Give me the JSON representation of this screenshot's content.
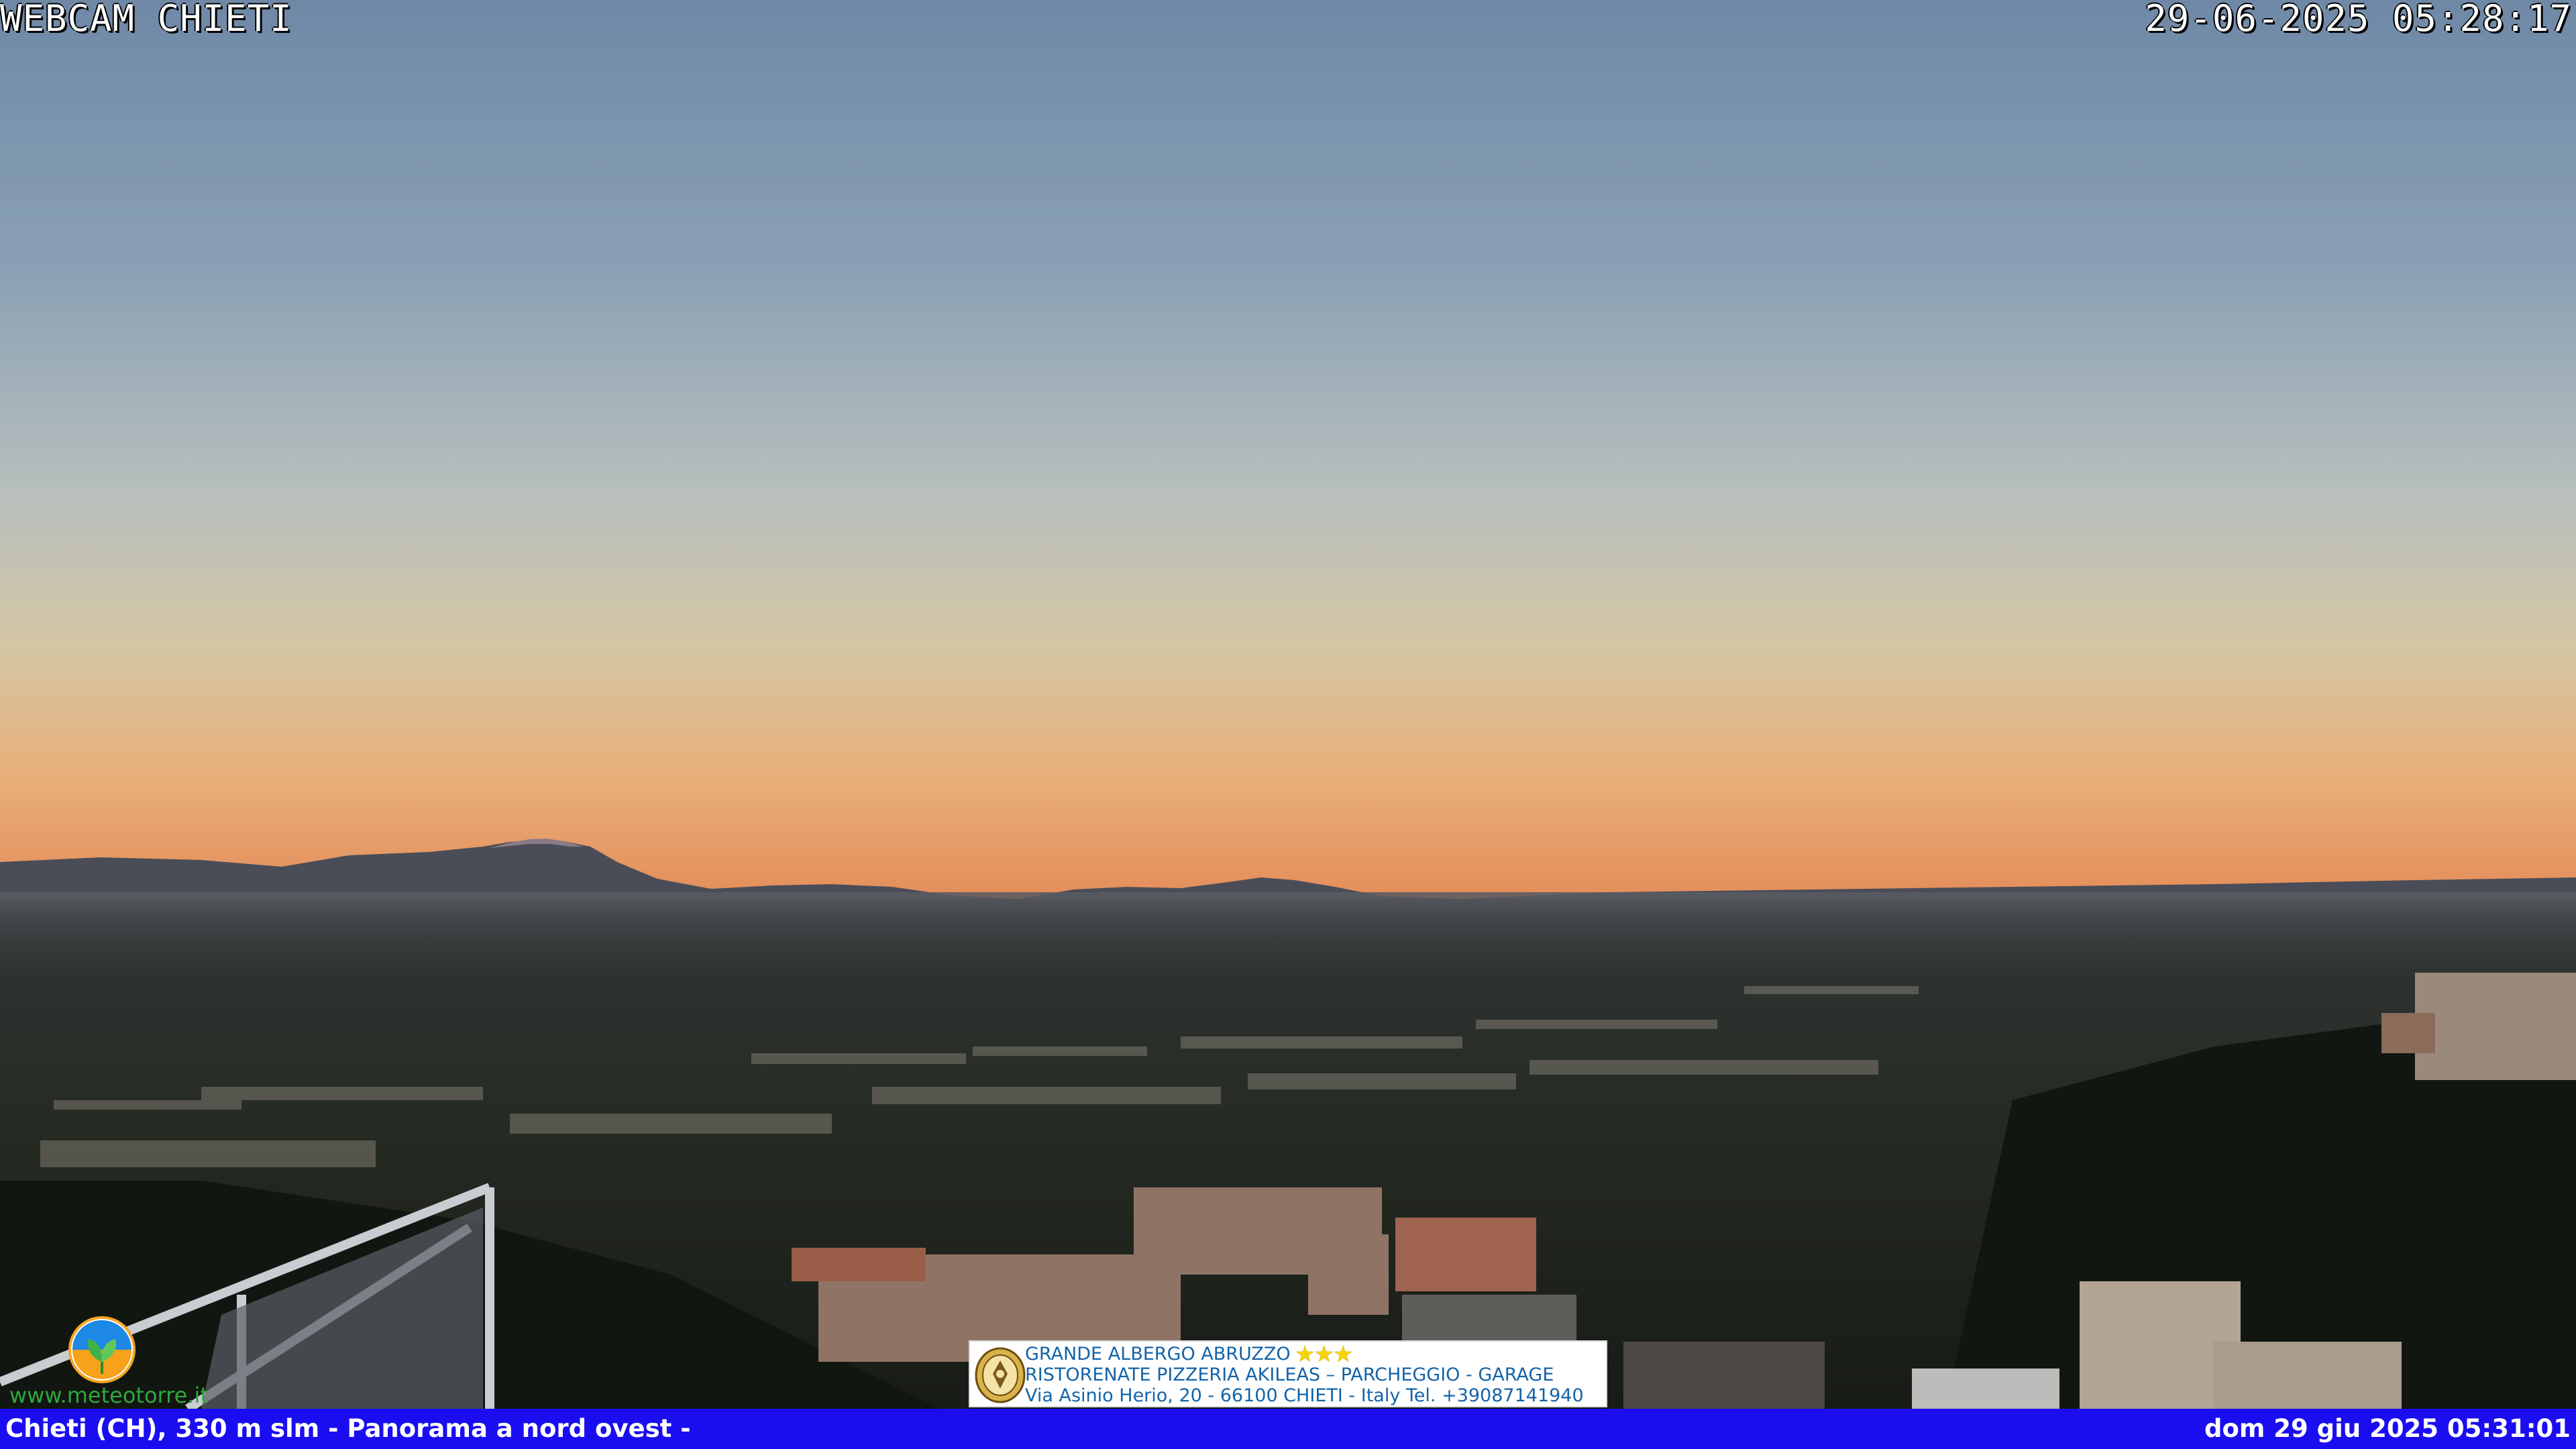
{
  "overlay": {
    "title": "WEBCAM CHIETI",
    "datetime": "29-06-2025 05:28:17"
  },
  "bottom_bar": {
    "caption": "Chieti (CH), 330 m slm - Panorama a nord ovest -",
    "capture_time": "dom 29 giu 2025 05:31:01",
    "background_color": "#1a0ef0"
  },
  "ad_banner": {
    "line1": "GRANDE ALBERGO ABRUZZO",
    "stars": "★★★",
    "line2": "RISTORENATE PIZZERIA AKILEAS – PARCHEGGIO - GARAGE",
    "line3": "Via Asinio Herio, 20 - 66100 CHIETI - Italy Tel. +39087141940"
  },
  "logo": {
    "icon": "leaf-sun-icon",
    "url": "www.meteotorre.it"
  },
  "scene": {
    "description_icon": "landscape-photo",
    "sky_top_color": "#6f88a6",
    "sky_horizon_color": "#e89a5c",
    "ground_color": "#1f231d"
  }
}
